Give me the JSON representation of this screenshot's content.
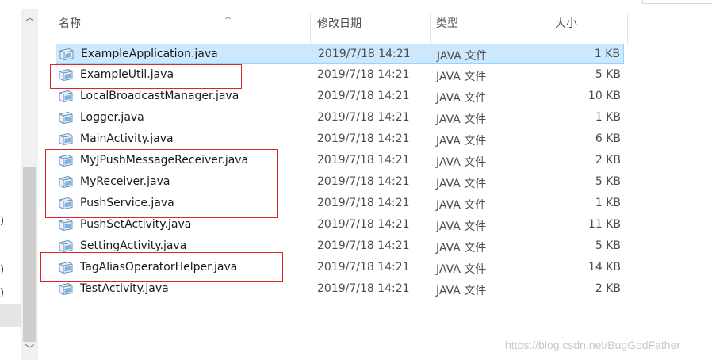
{
  "nav": {
    "paren_marks": [
      ")",
      ")",
      ")"
    ]
  },
  "columns": {
    "name": "名称",
    "date": "修改日期",
    "type": "类型",
    "size": "大小"
  },
  "files": [
    {
      "name": "ExampleApplication.java",
      "date": "2019/7/18 14:21",
      "type": "JAVA 文件",
      "size": "1 KB",
      "selected": true
    },
    {
      "name": "ExampleUtil.java",
      "date": "2019/7/18 14:21",
      "type": "JAVA 文件",
      "size": "5 KB"
    },
    {
      "name": "LocalBroadcastManager.java",
      "date": "2019/7/18 14:21",
      "type": "JAVA 文件",
      "size": "10 KB"
    },
    {
      "name": "Logger.java",
      "date": "2019/7/18 14:21",
      "type": "JAVA 文件",
      "size": "1 KB"
    },
    {
      "name": "MainActivity.java",
      "date": "2019/7/18 14:21",
      "type": "JAVA 文件",
      "size": "6 KB"
    },
    {
      "name": "MyJPushMessageReceiver.java",
      "date": "2019/7/18 14:21",
      "type": "JAVA 文件",
      "size": "2 KB"
    },
    {
      "name": "MyReceiver.java",
      "date": "2019/7/18 14:21",
      "type": "JAVA 文件",
      "size": "5 KB"
    },
    {
      "name": "PushService.java",
      "date": "2019/7/18 14:21",
      "type": "JAVA 文件",
      "size": "1 KB"
    },
    {
      "name": "PushSetActivity.java",
      "date": "2019/7/18 14:21",
      "type": "JAVA 文件",
      "size": "11 KB"
    },
    {
      "name": "SettingActivity.java",
      "date": "2019/7/18 14:21",
      "type": "JAVA 文件",
      "size": "5 KB"
    },
    {
      "name": "TagAliasOperatorHelper.java",
      "date": "2019/7/18 14:21",
      "type": "JAVA 文件",
      "size": "14 KB"
    },
    {
      "name": "TestActivity.java",
      "date": "2019/7/18 14:21",
      "type": "JAVA 文件",
      "size": "2 KB"
    }
  ],
  "file_icon": "java-file-icon",
  "colors": {
    "selection_bg": "#cce8ff",
    "selection_border": "#99d1ff",
    "annotation_red": "#e0242b"
  },
  "watermark": "https://blog.csdn.net/BugGodFather"
}
